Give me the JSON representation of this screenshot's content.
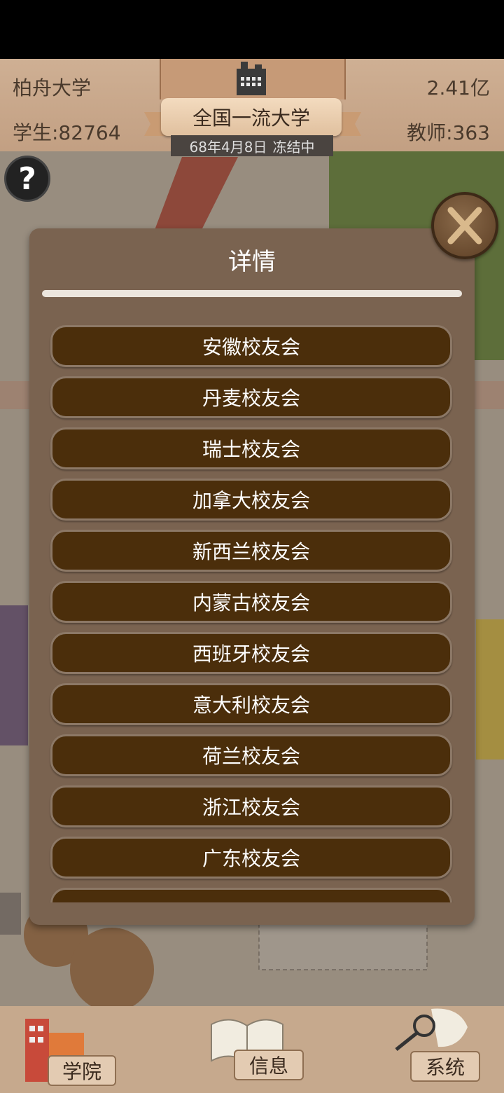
{
  "header": {
    "university_name": "柏舟大学",
    "funds": "2.41亿",
    "students": "学生:82764",
    "teachers": "教师:363",
    "rank": "全国一流大学",
    "date": "68年4月8日",
    "status": "冻结中"
  },
  "help": {
    "icon": "question-mark-icon",
    "label": "?"
  },
  "modal": {
    "title": "详情",
    "items": [
      "安徽校友会",
      "丹麦校友会",
      "瑞士校友会",
      "加拿大校友会",
      "新西兰校友会",
      "内蒙古校友会",
      "西班牙校友会",
      "意大利校友会",
      "荷兰校友会",
      "浙江校友会",
      "广东校友会"
    ]
  },
  "nav": {
    "college": "学院",
    "info": "信息",
    "system": "系统"
  },
  "colors": {
    "header_bg": "#c9aa8e",
    "modal_bg": "#7a6350",
    "item_bg": "#4b2e0b",
    "nav_bg": "#c6a98d"
  }
}
